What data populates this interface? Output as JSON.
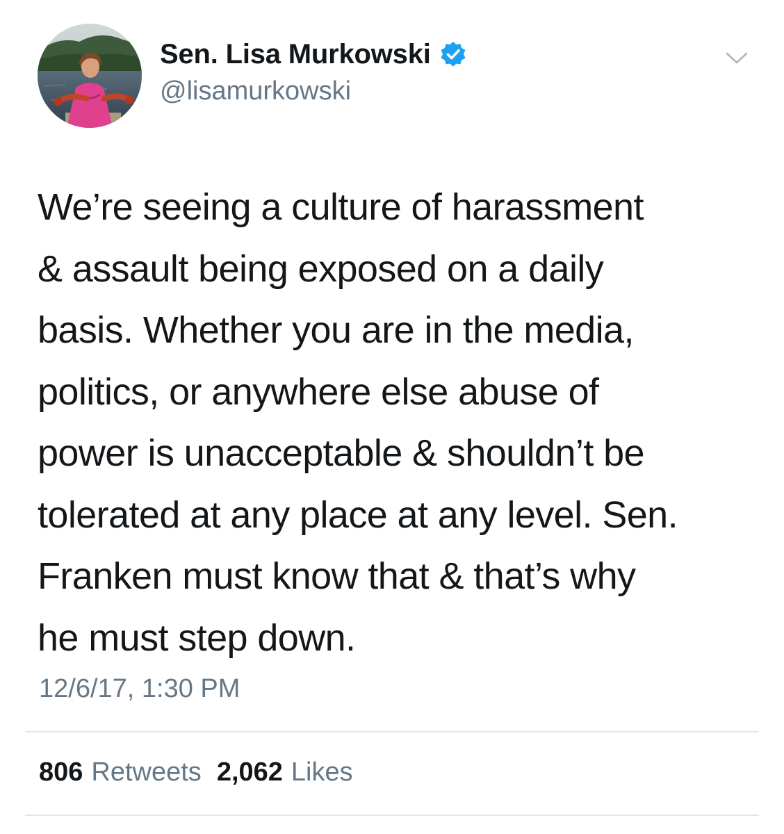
{
  "author": {
    "display_name": "Sen. Lisa Murkowski",
    "handle": "@lisamurkowski",
    "verified": true,
    "avatar_icon": "profile-photo",
    "verified_icon": "verified-badge-icon"
  },
  "tweet": {
    "lines": [
      "We’re seeing a culture of harassment",
      "& assault being exposed on a daily",
      "basis. Whether you are in the media,",
      "politics, or anywhere else abuse of",
      "power is unacceptable & shouldn’t be",
      "tolerated at any place at any level. Sen.",
      "Franken must know that & that’s why",
      "he must step down."
    ],
    "timestamp": "12/6/17, 1:30 PM"
  },
  "stats": {
    "retweets_count": "806",
    "retweets_label": "Retweets",
    "likes_count": "2,062",
    "likes_label": "Likes"
  },
  "colors": {
    "text_primary": "#14171a",
    "text_secondary": "#657786",
    "verified_blue": "#1da1f2",
    "divider": "#e1e8ed"
  },
  "icons": {
    "menu": "chevron-down-icon"
  }
}
